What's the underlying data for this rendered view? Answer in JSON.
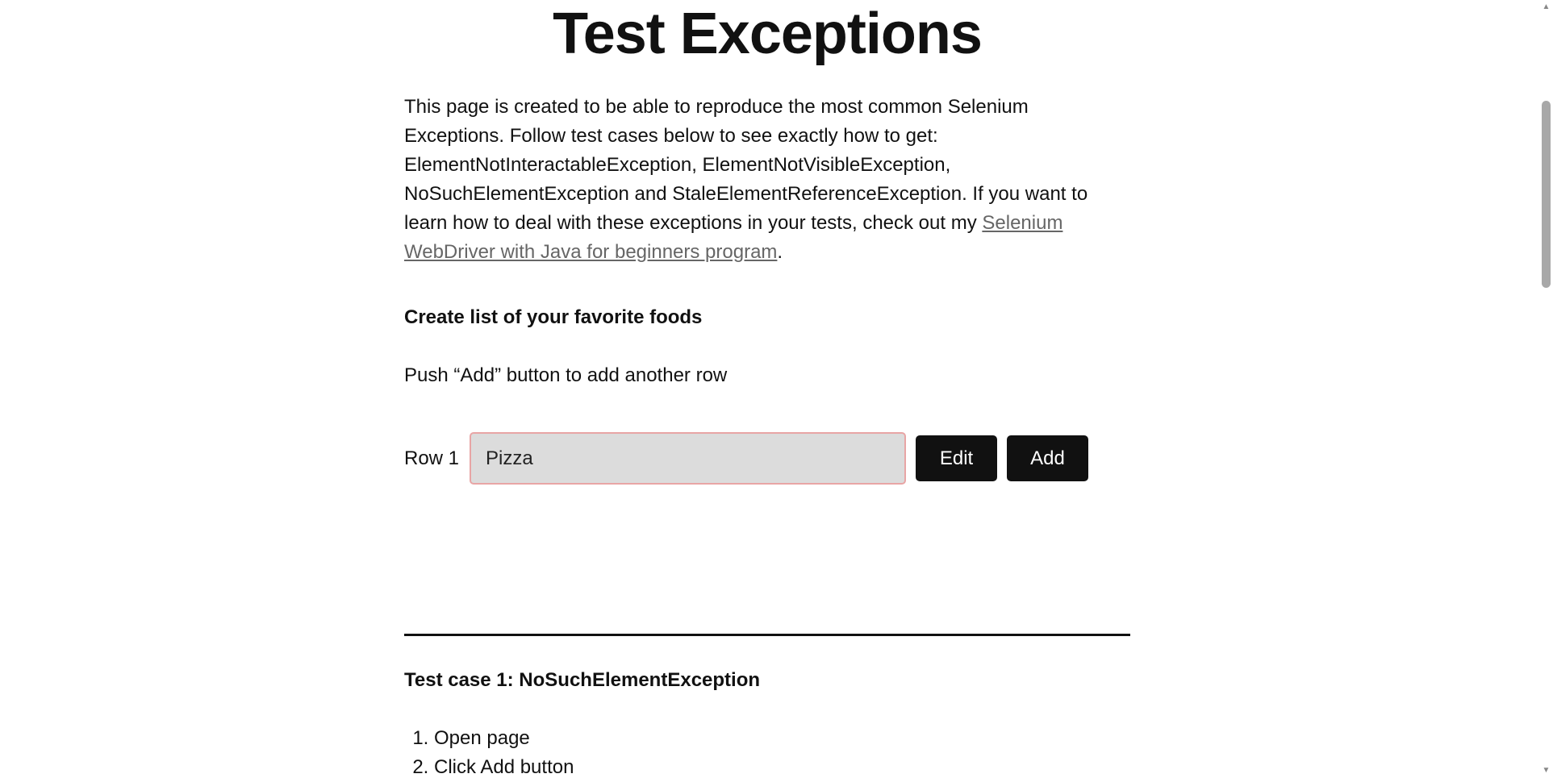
{
  "page": {
    "title": "Test Exceptions",
    "intro_text": "This page is created to be able to reproduce the most common Selenium Exceptions. Follow test cases below to see exactly how to get: ElementNotInteractableException, ElementNotVisibleException, NoSuchElementException and StaleElementReferenceException. If you want to learn how to deal with these exceptions in your tests, check out my ",
    "intro_link": "Selenium WebDriver with Java for beginners program",
    "intro_end": ".",
    "list_heading": "Create list of your favorite foods",
    "instruction": "Push “Add” button to add another row"
  },
  "row1": {
    "label": "Row 1",
    "value": "Pizza",
    "edit_label": "Edit",
    "add_label": "Add"
  },
  "test_case_1": {
    "heading": "Test case 1: NoSuchElementException",
    "steps": [
      "Open page",
      "Click Add button"
    ]
  },
  "colors": {
    "button_bg": "#111111",
    "input_bg": "#dcdcdc",
    "input_border": "#e8a5a5",
    "link": "#666666"
  },
  "scrollbar": {
    "up_icon": "triangle-up-icon",
    "down_icon": "triangle-down-icon"
  }
}
